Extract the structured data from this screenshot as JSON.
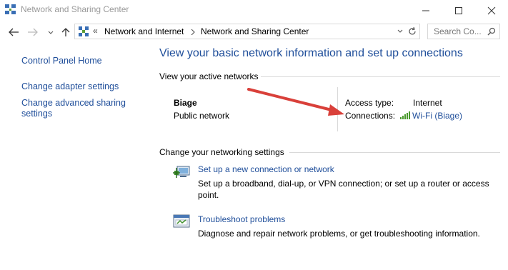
{
  "window": {
    "title": "Network and Sharing Center"
  },
  "navigation": {
    "overflow_chevron": "«",
    "breadcrumbs": [
      "Network and Internet",
      "Network and Sharing Center"
    ],
    "search_placeholder": "Search Co..."
  },
  "sidebar": {
    "items": [
      {
        "label": "Control Panel Home"
      },
      {
        "label": "Change adapter settings"
      },
      {
        "label": "Change advanced sharing settings"
      }
    ]
  },
  "main": {
    "heading": "View your basic network information and set up connections",
    "active_networks": {
      "section_label": "View your active networks",
      "network_name": "Biage",
      "network_category": "Public network",
      "access_type_label": "Access type:",
      "access_type_value": "Internet",
      "connections_label": "Connections:",
      "connection_value": "Wi-Fi (Biage)"
    },
    "change_settings": {
      "section_label": "Change your networking settings",
      "tasks": [
        {
          "title": "Set up a new connection or network",
          "description": "Set up a broadband, dial-up, or VPN connection; or set up a router or access point."
        },
        {
          "title": "Troubleshoot problems",
          "description": "Diagnose and repair network problems, or get troubleshooting information."
        }
      ]
    }
  },
  "colors": {
    "link": "#1f4e9a",
    "annotation_arrow": "#d9403a"
  }
}
